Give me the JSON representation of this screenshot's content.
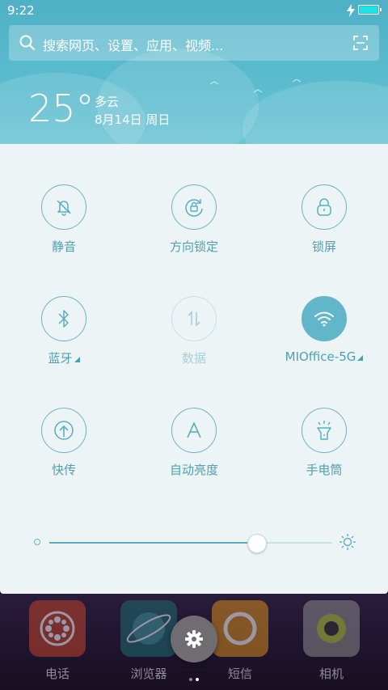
{
  "status_bar": {
    "time": "9:22"
  },
  "search": {
    "placeholder": "搜索网页、设置、应用、视频..."
  },
  "weather": {
    "temperature": "25°",
    "condition": "多云",
    "date": "8月14日 周日"
  },
  "quick_settings": {
    "toggles": [
      {
        "label": "静音",
        "icon": "mute-icon",
        "active": false,
        "disabled": false
      },
      {
        "label": "方向锁定",
        "icon": "rotation-lock-icon",
        "active": false,
        "disabled": false
      },
      {
        "label": "锁屏",
        "icon": "lock-icon",
        "active": false,
        "disabled": false
      },
      {
        "label": "蓝牙",
        "icon": "bluetooth-icon",
        "active": false,
        "disabled": false,
        "has_submenu": true
      },
      {
        "label": "数据",
        "icon": "mobile-data-icon",
        "active": false,
        "disabled": true
      },
      {
        "label": "MIOffice-5G",
        "icon": "wifi-icon",
        "active": true,
        "disabled": false,
        "has_submenu": true
      },
      {
        "label": "快传",
        "icon": "quick-transfer-icon",
        "active": false,
        "disabled": false
      },
      {
        "label": "自动亮度",
        "icon": "auto-brightness-icon",
        "active": false,
        "disabled": false
      },
      {
        "label": "手电筒",
        "icon": "flashlight-icon",
        "active": false,
        "disabled": false
      }
    ],
    "brightness": {
      "level": 0.73
    }
  },
  "dock": {
    "apps": [
      {
        "label": "电话",
        "icon": "phone-app-icon"
      },
      {
        "label": "浏览器",
        "icon": "browser-app-icon"
      },
      {
        "label": "短信",
        "icon": "messages-app-icon"
      },
      {
        "label": "相机",
        "icon": "camera-app-icon"
      }
    ]
  },
  "colors": {
    "accent": "#62b6c9",
    "header": "#5cbccf",
    "panel": "#edf4f6",
    "battery": "#19e6e6"
  }
}
